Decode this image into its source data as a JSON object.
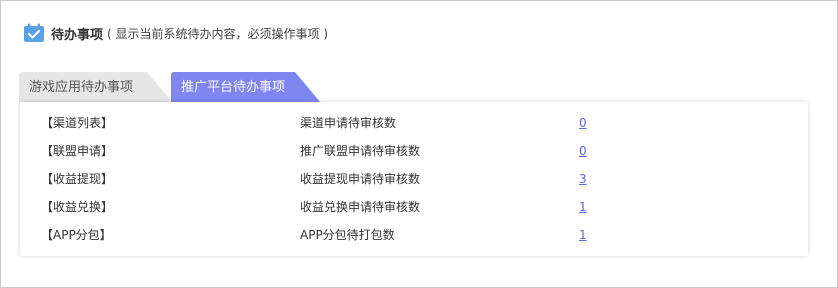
{
  "header": {
    "title": "待办事项",
    "subtitle": "( 显示当前系统待办内容，必须操作事项 )",
    "icon": "calendar-check-icon"
  },
  "tabs": [
    {
      "label": "游戏应用待办事项",
      "active": false
    },
    {
      "label": "推广平台待办事项",
      "active": true
    }
  ],
  "colors": {
    "accent": "#7f86f0",
    "link": "#5a64d8",
    "icon": "#5aa0e6"
  },
  "rows": [
    {
      "name": "【渠道列表】",
      "desc": "渠道申请待审核数",
      "count": "0"
    },
    {
      "name": "【联盟申请】",
      "desc": "推广联盟申请待审核数",
      "count": "0"
    },
    {
      "name": "【收益提现】",
      "desc": "收益提现申请待审核数",
      "count": "3"
    },
    {
      "name": "【收益兑换】",
      "desc": "收益兑换申请待审核数",
      "count": "1"
    },
    {
      "name": "【APP分包】",
      "desc": "APP分包待打包数",
      "count": "1"
    }
  ]
}
